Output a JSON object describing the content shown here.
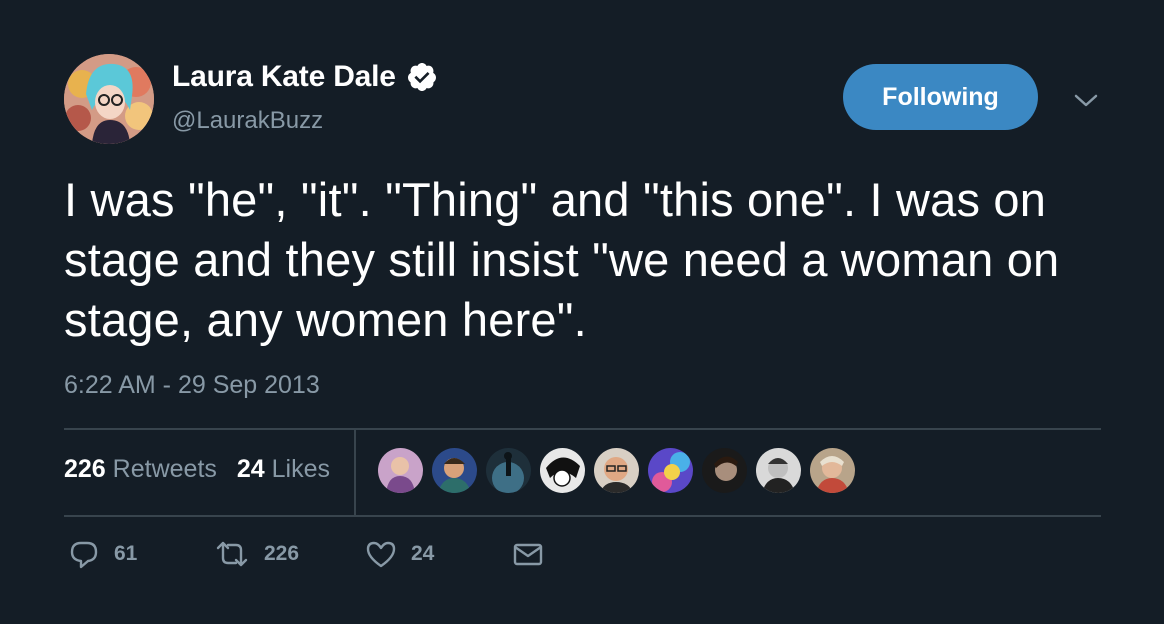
{
  "user": {
    "display_name": "Laura Kate Dale",
    "handle": "@LaurakBuzz",
    "avatar_icon": "profile-avatar",
    "verified_icon": "verified-badge-icon"
  },
  "follow_button": {
    "label": "Following"
  },
  "tweet": {
    "text": "I was \"he\", \"it\". \"Thing\" and \"this one\". I was on stage and they still insist \"we need a woman on stage, any women here\".",
    "timestamp": "6:22 AM - 29 Sep 2013"
  },
  "stats": {
    "retweets_count": "226",
    "retweets_label": "Retweets",
    "likes_count": "24",
    "likes_label": "Likes"
  },
  "actions": {
    "reply_count": "61",
    "retweet_count": "226",
    "like_count": "24"
  },
  "colors": {
    "background": "#141d26",
    "accent": "#3b88c3",
    "muted_text": "#8899a6",
    "divider": "#38444d"
  }
}
